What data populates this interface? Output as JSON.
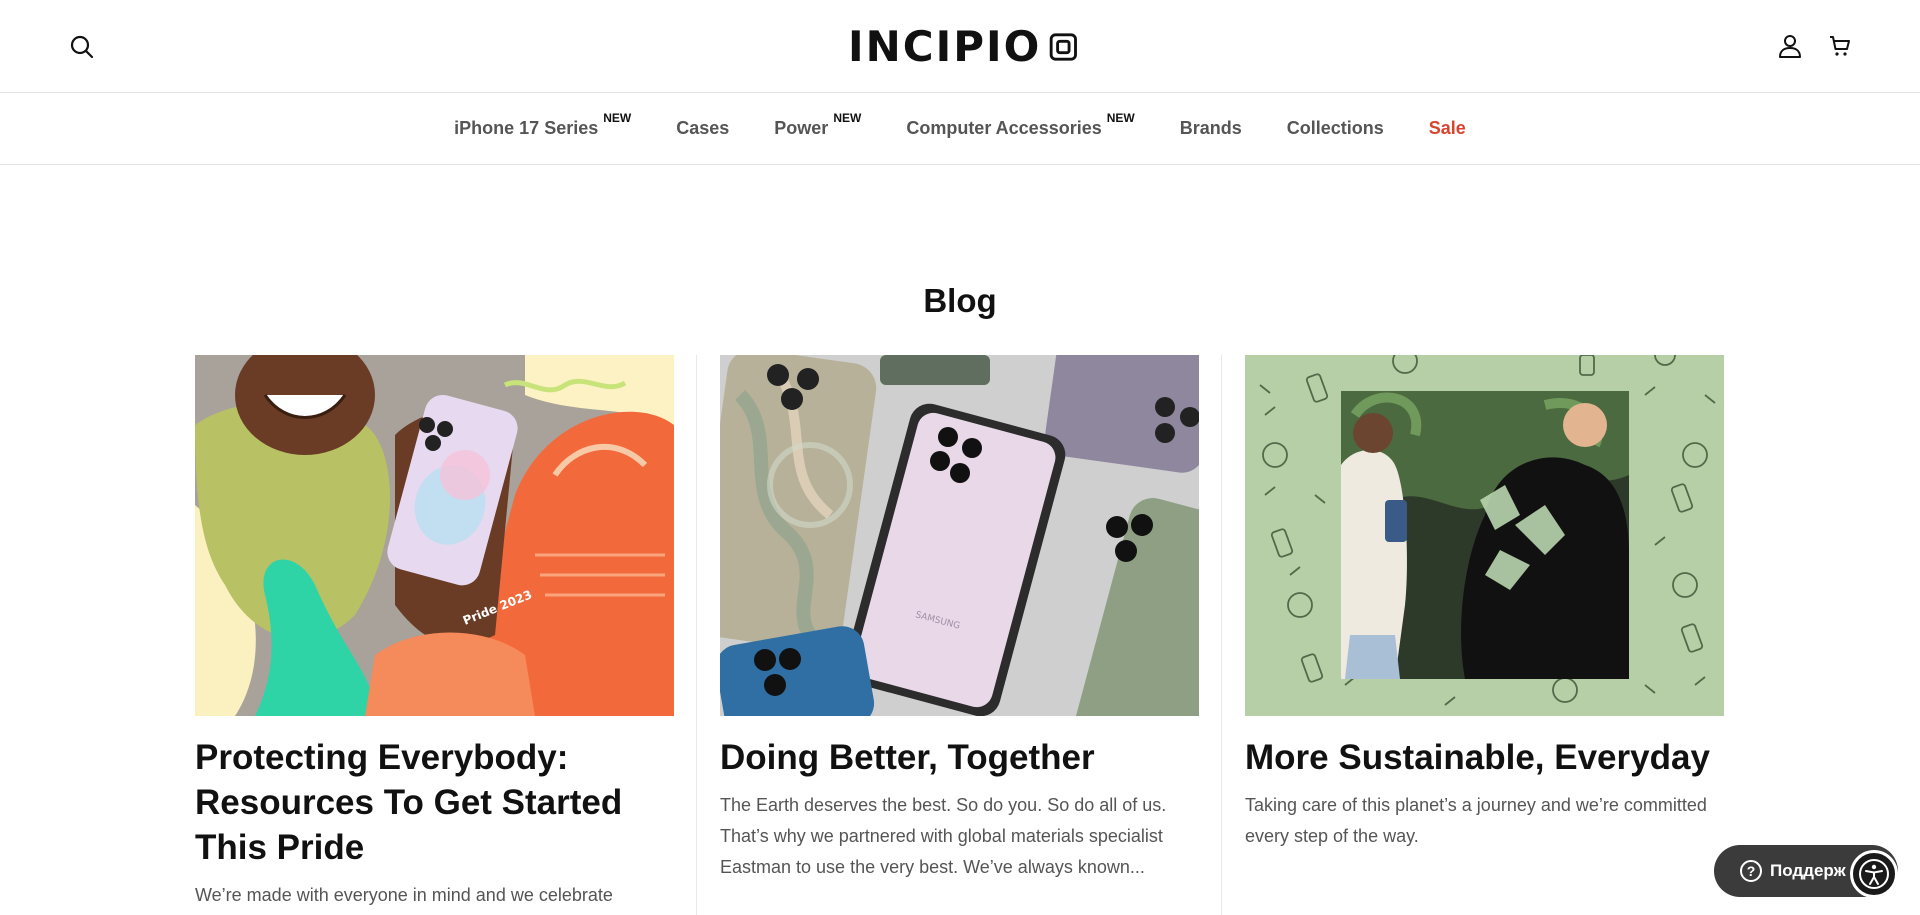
{
  "brand": {
    "logo_text": "INCIPIO"
  },
  "header": {
    "search_icon": "search-icon",
    "account_icon": "user-icon",
    "cart_icon": "cart-icon"
  },
  "nav": {
    "items": [
      {
        "label": "iPhone 17 Series",
        "badge": "NEW"
      },
      {
        "label": "Cases",
        "badge": ""
      },
      {
        "label": "Power",
        "badge": "NEW"
      },
      {
        "label": "Computer Accessories",
        "badge": "NEW"
      },
      {
        "label": "Brands",
        "badge": ""
      },
      {
        "label": "Collections",
        "badge": ""
      },
      {
        "label": "Sale",
        "badge": ""
      }
    ],
    "sale_color": "#d9442e"
  },
  "main": {
    "title": "Blog",
    "posts": [
      {
        "title": "Protecting Everybody: Resources To Get Started This Pride",
        "excerpt": "We’re made with everyone in mind and we celebrate",
        "image_text": "Pride 2023"
      },
      {
        "title": "Doing Better, Together",
        "excerpt": "The Earth deserves the best. So do you. So do all of us. That’s why we partnered with global materials specialist Eastman to use the very best. We’ve always known..."
      },
      {
        "title": "More Sustainable, Everyday",
        "excerpt": "Taking care of this planet’s a journey and we’re committed every step of the way."
      }
    ]
  },
  "widgets": {
    "support_label": "Поддерж",
    "accessibility_icon": "accessibility-icon"
  }
}
